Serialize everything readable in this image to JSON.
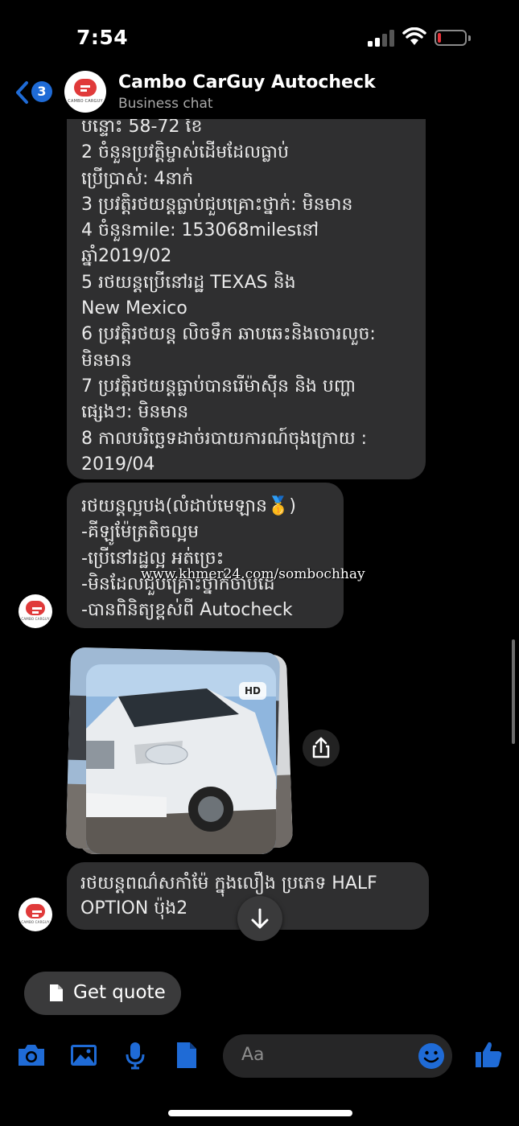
{
  "status_bar": {
    "time": "7:54"
  },
  "header": {
    "back_badge": "3",
    "title": "Cambo CarGuy Autocheck",
    "subtitle": "Business chat",
    "logo_text": "CAMBO CARGUY"
  },
  "messages": {
    "report_lines": [
      "បន្ទោះ 58-72 ខែ",
      "2 ចំនួនប្រវត្តិម្ចាស់ដើមដែលធ្លាប់",
      "ប្រើប្រាស់: 4នាក់",
      "3 ប្រវត្តិរថយន្តធ្លាប់ជួបគ្រោះថ្នាក់: មិនមាន",
      "4 ចំនួនmile: 153068milesនៅ",
      "ឆ្នាំ2019/02",
      "5 រថយន្តប្រើនៅរដ្ឋ TEXAS និង",
      "New Mexico",
      "6 ប្រវត្តិរថយន្ត លិចទឹក ឆាបឆេះនិងចោរលួច:",
      "មិនមាន",
      "7 ប្រវត្តិរថយន្តធ្លាប់បានរើម៉ាស៊ីន និង បញ្ហា",
      "ផ្សេងៗ: មិនមាន",
      "8 កាលបរិច្ឆេទដាច់របាយការណ៍ចុងក្រោយ :",
      "2019/04"
    ],
    "summary_lines": [
      "រថយន្តល្អបង(លំដាប់មេឡាន🥇)",
      "-គីឡូម៉ែត្រតិចល្អម",
      "-ប្រើនៅរដ្ឋល្អ អត់ច្រេះ",
      "-មិនដែលជួបគ្រោះថ្នាក់ចាបដេ",
      "-បានពិនិត្យខ្ពស់ពី Autocheck"
    ],
    "watermark": "www.khmer24.com/sombochhay",
    "photo_badge": "HD",
    "last_lines": [
      "រថយន្តពណ៌សកាំម៉ែ ក្នុងលឿង ប្រភេទ HALF",
      "OPTION ប៉ុង2"
    ]
  },
  "quick_reply": {
    "label": "Get quote"
  },
  "composer": {
    "placeholder": "Aa"
  },
  "colors": {
    "accent": "#1f6bd6",
    "bubble": "#2f2f30",
    "brand_red": "#e03a3a"
  }
}
